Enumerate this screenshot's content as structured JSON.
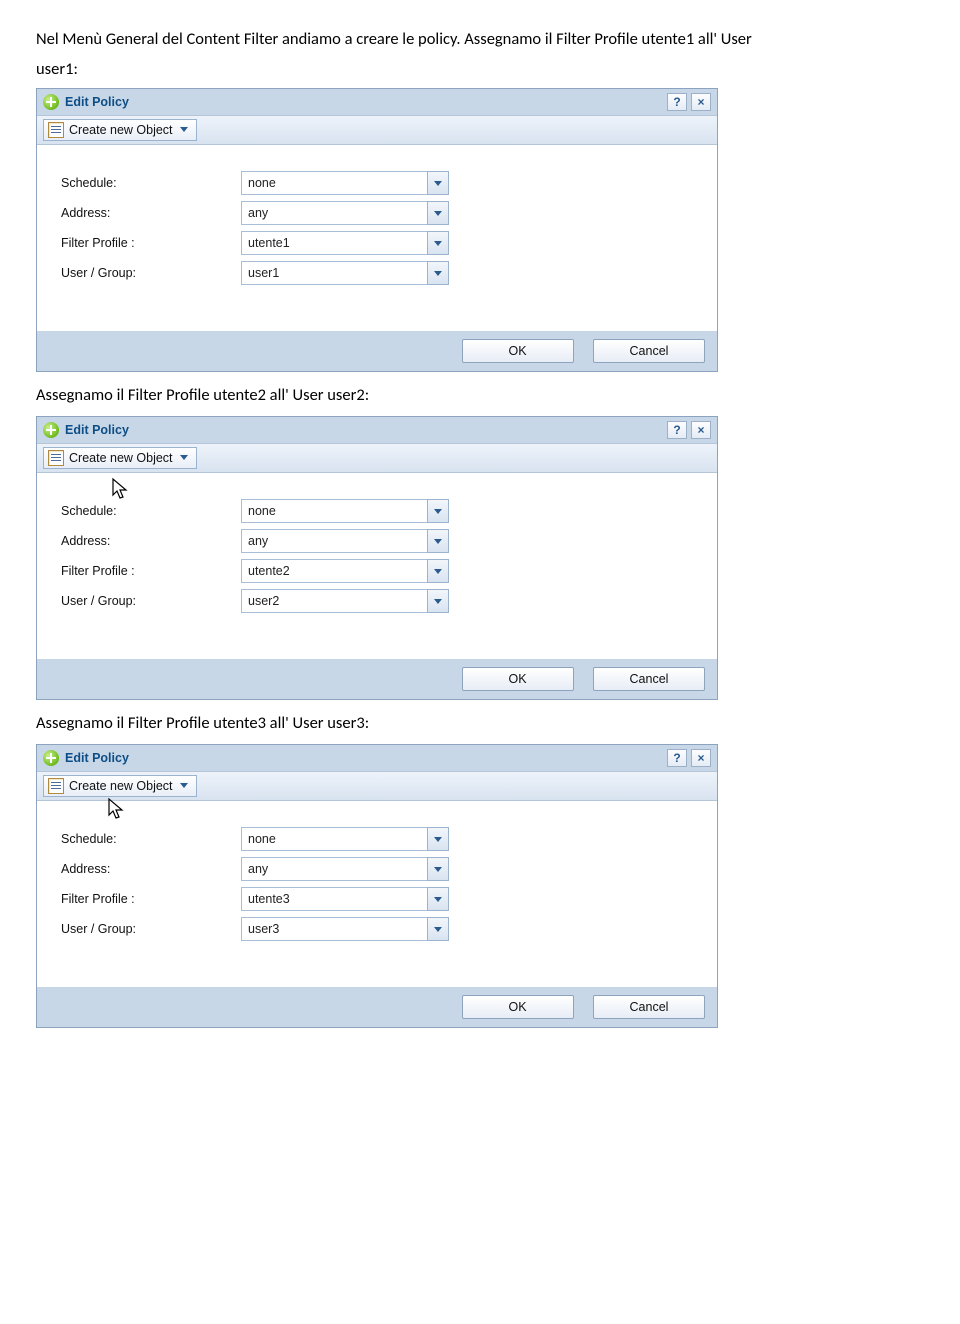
{
  "intro": {
    "line1": "Nel Menù General del Content Filter andiamo a creare le policy. Assegnamo il Filter Profile utente1 all' User",
    "line2": "user1:"
  },
  "labels": {
    "dialog_title": "Edit Policy",
    "create_object": "Create new Object",
    "schedule": "Schedule:",
    "address": "Address:",
    "filter_profile": "Filter Profile :",
    "user_group": "User / Group:",
    "ok": "OK",
    "cancel": "Cancel",
    "help": "?",
    "close": "×"
  },
  "dlg1": {
    "schedule": "none",
    "address": "any",
    "filter_profile": "utente1",
    "user_group": "user1"
  },
  "caption2": "Assegnamo il Filter Profile utente2 all' User user2:",
  "dlg2": {
    "schedule": "none",
    "address": "any",
    "filter_profile": "utente2",
    "user_group": "user2"
  },
  "caption3": "Assegnamo il Filter Profile utente3 all' User user3:",
  "dlg3": {
    "schedule": "none",
    "address": "any",
    "filter_profile": "utente3",
    "user_group": "user3"
  }
}
